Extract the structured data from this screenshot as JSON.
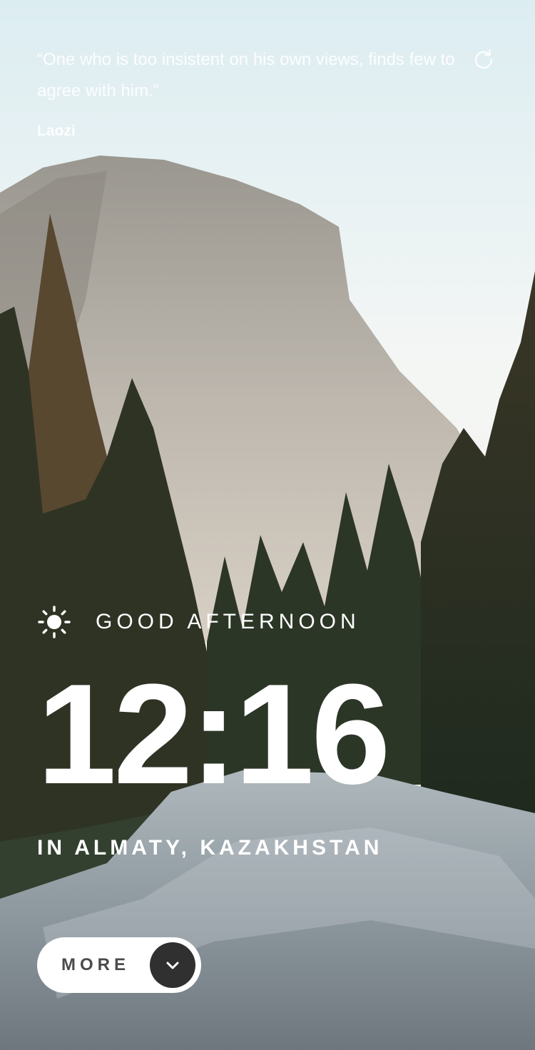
{
  "quote": {
    "text": "“One who is too insistent on his own views, finds few to agree with him.”",
    "author": "Laozi"
  },
  "controls": {
    "refresh_icon": "refresh-icon"
  },
  "greeting": {
    "icon": "sun-icon",
    "text": "GOOD AFTERNOON"
  },
  "clock": {
    "time": "12:16"
  },
  "location": {
    "text": "IN ALMATY, KAZAKHSTAN"
  },
  "more_button": {
    "label": "MORE",
    "icon": "chevron-down-icon"
  },
  "colors": {
    "text": "#ffffff",
    "button_bg": "#ffffff",
    "button_text": "#4b4b4b",
    "chevron_bg": "#303030"
  }
}
